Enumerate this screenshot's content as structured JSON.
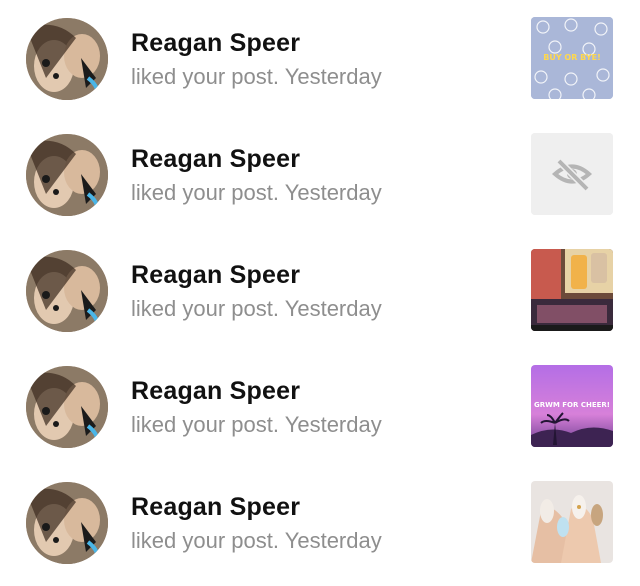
{
  "notifications": [
    {
      "user_name": "Reagan Speer",
      "action": "liked your post.",
      "time": "Yesterday",
      "thumb_icon": "smiley-pattern",
      "thumb_text": "BUY OR BYE!"
    },
    {
      "user_name": "Reagan Speer",
      "action": "liked your post.",
      "time": "Yesterday",
      "thumb_icon": "eye-slash-icon",
      "thumb_text": ""
    },
    {
      "user_name": "Reagan Speer",
      "action": "liked your post.",
      "time": "Yesterday",
      "thumb_icon": "products-photo",
      "thumb_text": ""
    },
    {
      "user_name": "Reagan Speer",
      "action": "liked your post.",
      "time": "Yesterday",
      "thumb_icon": "sunset-photo",
      "thumb_text": "GRWM FOR CHEER!"
    },
    {
      "user_name": "Reagan Speer",
      "action": "liked your post.",
      "time": "Yesterday",
      "thumb_icon": "nails-photo",
      "thumb_text": ""
    }
  ],
  "colors": {
    "name": "#111111",
    "secondary": "#8e8e8e",
    "hidden_thumb_bg": "#efefef"
  }
}
